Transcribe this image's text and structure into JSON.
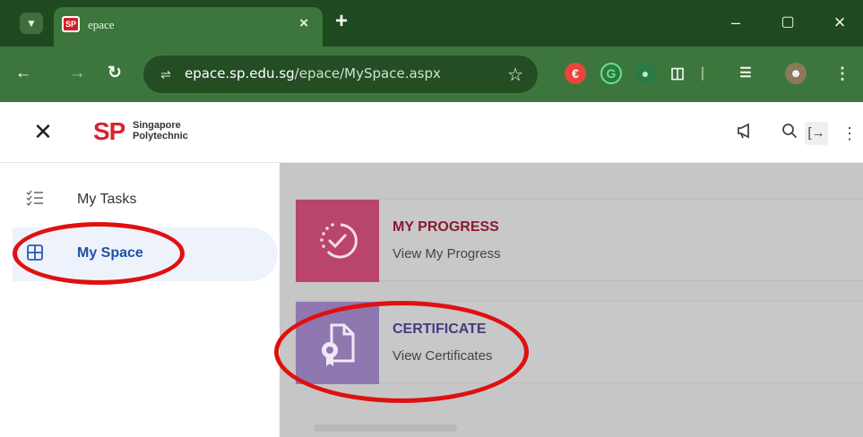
{
  "browser": {
    "tab_title": "epace",
    "favicon_text": "SP",
    "url_domain": "epace.sp.edu.sg",
    "url_path": "/epace/MySpace.aspx",
    "tab_close": "×",
    "new_tab": "+",
    "window_controls": {
      "minimize": "–",
      "maximize": "▢",
      "close": "×"
    }
  },
  "app": {
    "logo_mark": "SP",
    "logo_line1": "Singapore",
    "logo_line2": "Polytechnic",
    "close_glyph": "✕"
  },
  "sidebar": {
    "items": [
      {
        "label": "My Tasks",
        "icon": "task-list-icon",
        "active": false
      },
      {
        "label": "My Space",
        "icon": "grid-icon",
        "active": true
      }
    ]
  },
  "cards": [
    {
      "title": "MY PROGRESS",
      "subtitle": "View My Progress",
      "icon": "progress-check-icon",
      "color": "#b9456d",
      "title_color": "#8a1a33"
    },
    {
      "title": "CERTIFICATE",
      "subtitle": "View Certificates",
      "icon": "certificate-icon",
      "color": "#8f77b0",
      "title_color": "#4a3880"
    }
  ],
  "colors": {
    "chrome_dark": "#1f4a1f",
    "chrome_mid": "#3c763c",
    "annotation_red": "#e01010",
    "active_blue": "#1f4fa8"
  }
}
